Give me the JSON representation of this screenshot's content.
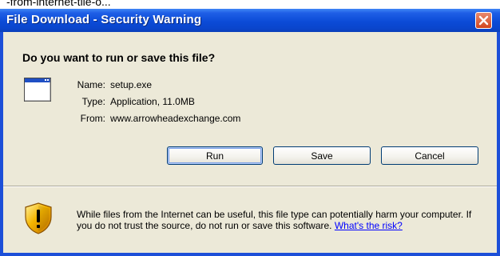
{
  "background_caption": "-from-internet-tile-o...",
  "window": {
    "title": "File Download - Security Warning",
    "close_icon": "close-icon"
  },
  "dialog": {
    "question": "Do you want to run or save this file?",
    "file_icon": "application-window-icon",
    "fields": [
      {
        "label": "Name:",
        "value": "setup.exe"
      },
      {
        "label": "Type:",
        "value": "Application, 11.0MB"
      },
      {
        "label": "From:",
        "value": "www.arrowheadexchange.com"
      }
    ]
  },
  "buttons": {
    "run": "Run",
    "save": "Save",
    "cancel": "Cancel"
  },
  "warning": {
    "icon": "security-shield-icon",
    "text": "While files from the Internet can be useful, this file type can potentially harm your computer. If you do not trust the source, do not run or save this software.",
    "link": "What's the risk?"
  },
  "colors": {
    "titlebar": "#0a45cc",
    "client_background": "#ece9d8",
    "close_button": "#d2451e",
    "link": "#0000ff"
  }
}
